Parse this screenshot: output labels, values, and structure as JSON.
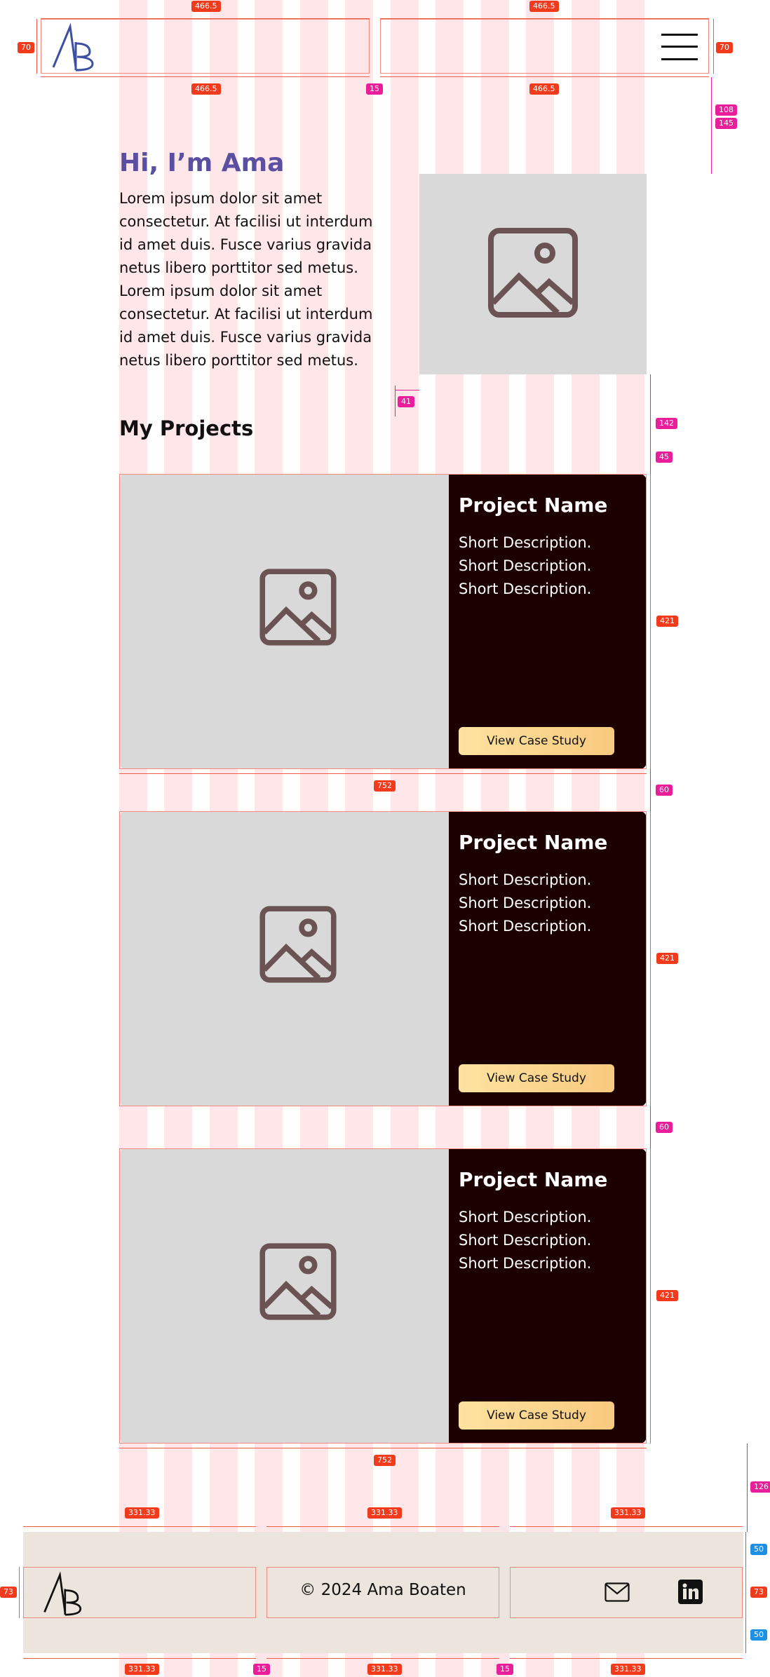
{
  "header": {
    "logo_text": "AB",
    "menu_icon": "hamburger-icon"
  },
  "hero": {
    "title": "Hi, I’m Ama",
    "paragraph": "Lorem ipsum dolor sit amet consectetur. At facilisi ut interdum id amet duis. Fusce varius gravida netus libero porttitor sed metus. Lorem ipsum dolor sit amet consectetur. At facilisi ut interdum id amet duis. Fusce varius gravida netus libero porttitor sed metus.",
    "image_icon": "image-placeholder-icon"
  },
  "projects": {
    "title": "My Projects",
    "items": [
      {
        "name": "Project Name",
        "description": "Short Description. Short Description. Short Description.",
        "button": "View Case Study"
      },
      {
        "name": "Project Name",
        "description": "Short Description. Short Description. Short Description.",
        "button": "View Case Study"
      },
      {
        "name": "Project Name",
        "description": "Short Description. Short Description. Short Description.",
        "button": "View Case Study"
      }
    ]
  },
  "footer": {
    "logo_text": "AB",
    "copyright": "© 2024 Ama Boaten",
    "icons": [
      "mail-icon",
      "linkedin-icon"
    ]
  },
  "annotations": {
    "header_col_width": "466.5",
    "header_gutter": "15",
    "header_height": "70",
    "hero_top_1": "108",
    "hero_top_2": "145",
    "hero_gap": "41",
    "projects_gap_1": "142",
    "projects_gap_2": "45",
    "card_height": "421",
    "card_gap": "60",
    "card_width": "752",
    "footer_gap": "126",
    "footer_col_width": "331.33",
    "footer_gutter": "15",
    "footer_pad": "50",
    "footer_height": "73"
  },
  "colors": {
    "accent": "#5b4fa2",
    "card_dark": "#1c0000",
    "button": "#f8c97e",
    "footer_bg": "#ece5dd",
    "grid_overlay": "#ff697d"
  }
}
